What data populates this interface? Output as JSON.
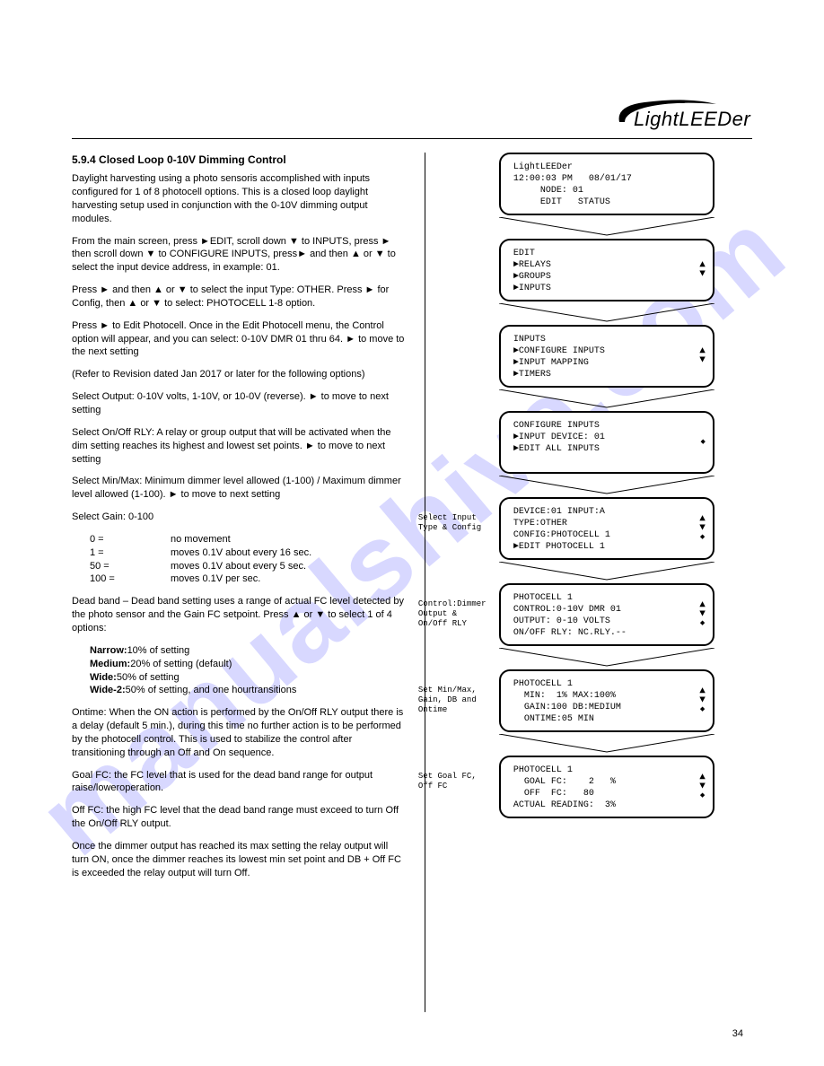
{
  "brand": "LightLEEDer",
  "watermark": "manualshive.com",
  "page_number": "34",
  "left": {
    "section": "5.9.4 Closed Loop 0-10V Dimming Control",
    "p1": "Daylight harvesting using a photo sensoris accomplished with inputs configured for 1 of 8 photocell options. This is a closed loop daylight harvesting setup used in conjunction with the 0-10V dimming output modules.",
    "p2": "From the main screen, press ►EDIT, scroll down ▼ to INPUTS, press ► then scroll down ▼ to CONFIGURE INPUTS, press► and then ▲ or ▼ to select the input device address, in example: 01.",
    "p3": "Press ► and then ▲ or ▼ to select the input Type: OTHER. Press ► for Config, then ▲ or ▼ to select: PHOTOCELL 1-8 option.",
    "p4": "Press ► to Edit Photocell. Once in the Edit Photocell menu, the Control option will appear, and you can select: 0-10V DMR 01 thru 64. ► to move to the next setting",
    "ref1": "(Refer to Revision dated Jan 2017 or later for the following options)",
    "p5": "Select Output: 0-10V volts, 1-10V, or 10-0V (reverse). ► to move to next setting",
    "p6": "Select On/Off RLY: A relay or group output that will be activated when the dim setting reaches its highest and lowest set points. ► to move to next setting",
    "p7": "Select Min/Max: Minimum dimmer level allowed (1-100) / Maximum dimmer level allowed (1-100). ► to move to next setting",
    "p8": "Select Gain: 0-100",
    "gain_list": [
      {
        "k": "0 =",
        "v": " no movement"
      },
      {
        "k": "1 =",
        "v": " moves 0.1V about every 16 sec."
      },
      {
        "k": "50 =",
        "v": " moves 0.1V about every 5 sec."
      },
      {
        "k": "100 =",
        "v": " moves 0.1V per sec."
      }
    ],
    "p9": "Dead band – Dead band setting uses a range of actual FC level detected by the photo sensor and the Gain FC setpoint. Press ▲ or ▼ to select 1 of 4 options:",
    "db_list": [
      {
        "k": "Narrow:",
        "v": " 10% of setting"
      },
      {
        "k": "Medium:",
        "v": " 20% of setting (default)"
      },
      {
        "k": "Wide:",
        "v": " 50% of setting"
      },
      {
        "k": "Wide-2:",
        "v": " 50% of setting, and one hourtransitions"
      }
    ],
    "p10": "Ontime: When the ON action is performed by the On/Off RLY output there is a delay (default 5 min.), during this time no further action is to be performed by the photocell control. This is used to stabilize the control after transitioning through an Off and On sequence.",
    "p11": "Goal FC: the FC level that is used for the dead band range for output raise/loweroperation.",
    "p12": "Off FC: the high FC level that the dead band range must exceed to turn Off the On/Off RLY output.",
    "p13": "Once the dimmer output has reached its max setting the relay output will turn ON, once the dimmer reaches its lowest min set point and DB + Off FC is exceeded the relay output will turn Off."
  },
  "panels": [
    {
      "lines": [
        "LightLEEDer",
        "12:00:03 PM   08/01/17",
        "     NODE: 01",
        "     EDIT   STATUS"
      ],
      "icons": []
    },
    {
      "lines": [
        "EDIT",
        "►RELAYS",
        "►GROUPS",
        "►INPUTS"
      ],
      "icons": [
        "up",
        "down"
      ]
    },
    {
      "lines": [
        "INPUTS",
        "►CONFIGURE INPUTS",
        "►INPUT MAPPING",
        "►TIMERS"
      ],
      "icons": [
        "up",
        "down"
      ]
    },
    {
      "lines": [
        "CONFIGURE INPUTS",
        "►INPUT DEVICE: 01",
        "",
        "►EDIT ALL INPUTS"
      ],
      "icons": [
        "sq"
      ]
    },
    {
      "lines": [
        "DEVICE:01 INPUT:A",
        "TYPE:OTHER",
        "CONFIG:PHOTOCELL 1",
        "►EDIT PHOTOCELL 1"
      ],
      "icons": [
        "up",
        "down",
        "sq"
      ],
      "side": "Select Input\nType & Config"
    },
    {
      "lines": [
        "PHOTOCELL 1",
        "CONTROL:0-10V DMR 01",
        "OUTPUT: 0-10 VOLTS",
        "ON/OFF RLY: NC.RLY.--"
      ],
      "icons": [
        "up",
        "down",
        "sq"
      ],
      "side": "Control:Dimmer\nOutput &\nOn/Off RLY"
    },
    {
      "lines": [
        "PHOTOCELL 1",
        "  MIN:  1% MAX:100%",
        "  GAIN:100 DB:MEDIUM",
        "  ONTIME:05 MIN"
      ],
      "icons": [
        "up",
        "down",
        "sq"
      ],
      "side": "Set Min/Max,\nGain, DB and\nOntime"
    },
    {
      "lines": [
        "PHOTOCELL 1",
        "  GOAL FC:    2   %",
        "  OFF  FC:   80",
        "ACTUAL READING:  3%"
      ],
      "icons": [
        "up",
        "down",
        "sq"
      ],
      "side": "Set Goal FC,\nOff FC"
    }
  ]
}
